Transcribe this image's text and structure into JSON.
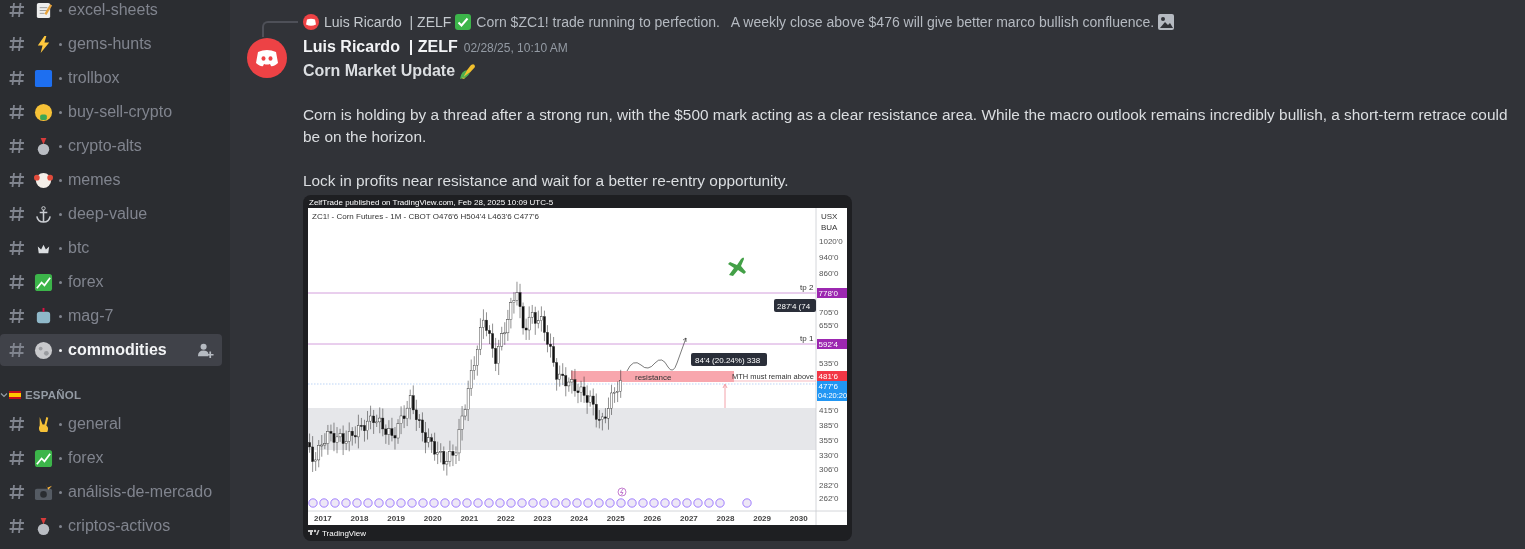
{
  "sidebar": {
    "channels": [
      {
        "name": "excel-sheets",
        "selected": false
      },
      {
        "name": "gems-hunts",
        "selected": false
      },
      {
        "name": "trollbox",
        "selected": false
      },
      {
        "name": "buy-sell-crypto",
        "selected": false
      },
      {
        "name": "crypto-alts",
        "selected": false
      },
      {
        "name": "memes",
        "selected": false
      },
      {
        "name": "deep-value",
        "selected": false
      },
      {
        "name": "btc",
        "selected": false
      },
      {
        "name": "forex",
        "selected": false
      },
      {
        "name": "mag-7",
        "selected": false
      },
      {
        "name": "commodities",
        "selected": true
      }
    ],
    "section": {
      "title": "ESPAÑOL",
      "expanded": true,
      "channels": [
        {
          "name": "general",
          "selected": false
        },
        {
          "name": "forex",
          "selected": false
        },
        {
          "name": "análisis-de-mercado",
          "selected": false
        },
        {
          "name": "criptos-activos",
          "selected": false
        }
      ]
    }
  },
  "reply": {
    "author": "Luis Ricardo  | ZELF",
    "text": "Corn $ZC1! trade running to perfection.   A weekly close above $476 will give better marco bullish confluence."
  },
  "message": {
    "author": "Luis Ricardo  | ZELF",
    "timestamp": "02/28/25, 10:10 AM",
    "title": "Corn Market Update",
    "paragraphs": [
      "Corn is holding by a thread after a strong run, with the $500 mark acting as a clear resistance area. While the macro outlook remains incredibly bullish, a short-term retrace could be on the horizon.",
      "Lock in profits near resistance and wait for a better re-entry opportunity."
    ],
    "chart_image": {
      "credit": "ZelfTrade published on TradingView.com, Feb 28, 2025 10:09 UTC-5",
      "legend": "ZC1! - Corn Futures - 1M - CBOT  O476'6  H504'4  L463'6  C477'6",
      "currency": "USX",
      "unit": "BUA",
      "price_scale": [
        "1020'0",
        "940'0",
        "860'0",
        "705'0",
        "655'0",
        "535'0",
        "415'0",
        "385'0",
        "355'0",
        "330'0",
        "306'0",
        "282'0",
        "262'0"
      ],
      "price_tags": [
        {
          "label": "778'0",
          "color": "#9c27b0"
        },
        {
          "label": "592'4",
          "color": "#9c27b0"
        },
        {
          "label": "481'6",
          "color": "#f23645"
        },
        {
          "label": "477'6",
          "sublabel": "04:20:20",
          "color": "#2196f3"
        }
      ],
      "lines": [
        {
          "label": "tp 2"
        },
        {
          "label": "tp 1"
        }
      ],
      "zone_label": "resistance",
      "note": "MTH must remain above",
      "measures": [
        "84'4 (20.24%) 338",
        "287'4 (74"
      ],
      "years": [
        "2017",
        "2018",
        "2019",
        "2020",
        "2021",
        "2022",
        "2023",
        "2024",
        "2025",
        "2026",
        "2027",
        "2028",
        "2029",
        "2030"
      ],
      "brand": "TradingView"
    }
  }
}
